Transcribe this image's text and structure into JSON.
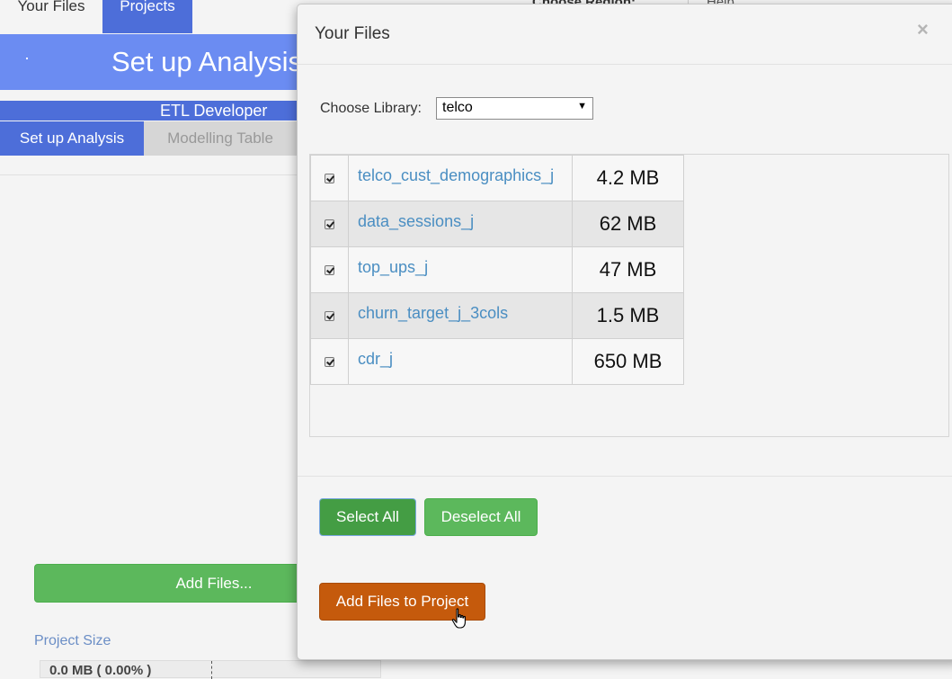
{
  "top_nav": {
    "tabs": [
      "Your Files",
      "Projects"
    ],
    "region_label": "Choose Region:",
    "help_label": "Help"
  },
  "banner": {
    "title": "Set up Analysis"
  },
  "role": {
    "title": "ETL Developer"
  },
  "subtabs": [
    "Set up Analysis",
    "Modelling Table"
  ],
  "background": {
    "add_files_label": "Add Files...",
    "project_size_label": "Project Size",
    "project_size_value": "0.0 MB ( 0.00% )",
    "project_size_fraction": 0.0
  },
  "modal": {
    "title": "Your Files",
    "close_glyph": "×",
    "library_label": "Choose Library:",
    "library_value": "telco",
    "library_arrow": "▼",
    "files": [
      {
        "name": "telco_cust_demographics_j",
        "size": "4.2 MB",
        "checked": true
      },
      {
        "name": "data_sessions_j",
        "size": "62 MB",
        "checked": true
      },
      {
        "name": "top_ups_j",
        "size": "47 MB",
        "checked": true
      },
      {
        "name": "churn_target_j_3cols",
        "size": "1.5 MB",
        "checked": true
      },
      {
        "name": "cdr_j",
        "size": "650 MB",
        "checked": true
      }
    ],
    "select_all_label": "Select All",
    "deselect_all_label": "Deselect All",
    "add_to_project_label": "Add Files to Project"
  },
  "colors": {
    "brand_blue": "#4d6ed9",
    "banner_blue": "#6b8cf2",
    "success_green": "#5cb85c",
    "active_green": "#449d44",
    "action_orange": "#c55a0c",
    "link_blue": "#4a8ec2"
  }
}
